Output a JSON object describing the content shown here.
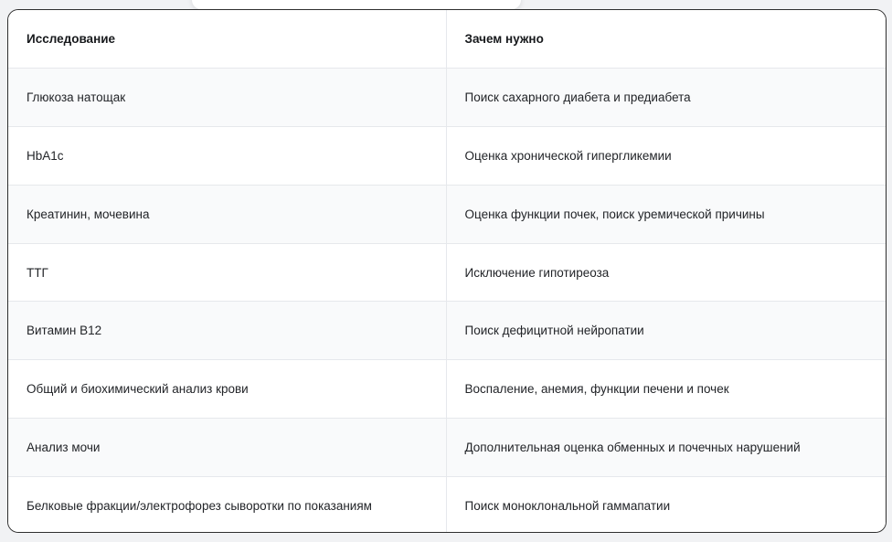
{
  "table": {
    "headers": [
      "Исследование",
      "Зачем нужно"
    ],
    "rows": [
      [
        "Глюкоза натощак",
        "Поиск сахарного диабета и предиабета"
      ],
      [
        "HbA1c",
        "Оценка хронической гипергликемии"
      ],
      [
        "Креатинин, мочевина",
        "Оценка функции почек, поиск уремической причины"
      ],
      [
        "ТТГ",
        "Исключение гипотиреоза"
      ],
      [
        "Витамин B12",
        "Поиск дефицитной нейропатии"
      ],
      [
        "Общий и биохимический анализ крови",
        "Воспаление, анемия, функции печени и почек"
      ],
      [
        "Анализ мочи",
        "Дополнительная оценка обменных и почечных нарушений"
      ],
      [
        "Белковые фракции/электрофорез сыворотки по показаниям",
        "Поиск моноклональной гаммапатии"
      ]
    ]
  }
}
